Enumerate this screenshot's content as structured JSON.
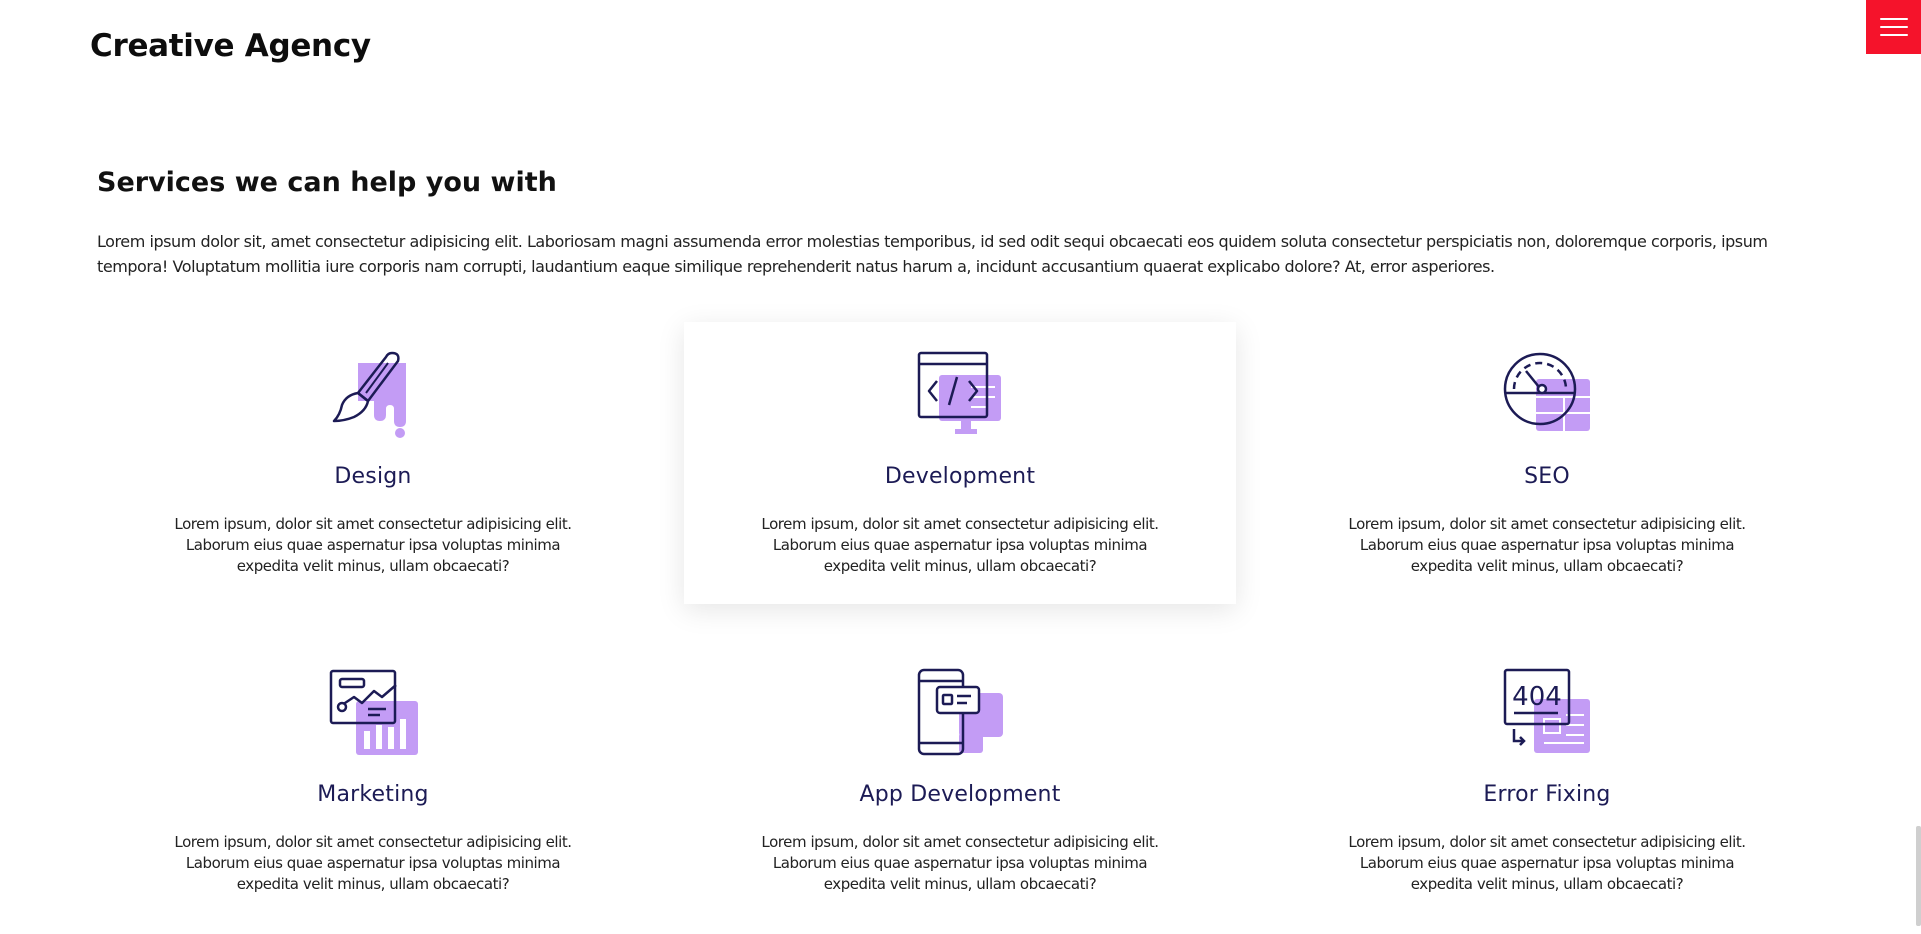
{
  "header": {
    "logo": "Creative Agency",
    "menu_icon": "hamburger-menu-icon",
    "menu_color": "#f5132b"
  },
  "services": {
    "title": "Services we can help you with",
    "description": "Lorem ipsum dolor sit, amet consectetur adipisicing elit. Laboriosam magni assumenda error molestias temporibus, id sed odit sequi obcaecati eos quidem soluta consectetur perspiciatis non, doloremque corporis, ipsum tempora! Voluptatum mollitia iure corporis nam corrupti, laudantium eaque similique reprehenderit natus harum a, incidunt accusantium quaerat explicabo dolore? At, error asperiores.",
    "accent_color": "#c39cf5",
    "icon_stroke_color": "#1c1b55",
    "items": [
      {
        "title": "Design",
        "icon": "paint-brush-icon",
        "text": "Lorem ipsum, dolor sit amet consectetur adipisicing elit. Laborum eius quae aspernatur ipsa voluptas minima expedita velit minus, ullam obcaecati?"
      },
      {
        "title": "Development",
        "icon": "code-monitor-icon",
        "text": "Lorem ipsum, dolor sit amet consectetur adipisicing elit. Laborum eius quae aspernatur ipsa voluptas minima expedita velit minus, ullam obcaecati?"
      },
      {
        "title": "SEO",
        "icon": "speedometer-icon",
        "text": "Lorem ipsum, dolor sit amet consectetur adipisicing elit. Laborum eius quae aspernatur ipsa voluptas minima expedita velit minus, ullam obcaecati?"
      },
      {
        "title": "Marketing",
        "icon": "analytics-chart-icon",
        "text": "Lorem ipsum, dolor sit amet consectetur adipisicing elit. Laborum eius quae aspernatur ipsa voluptas minima expedita velit minus, ullam obcaecati?"
      },
      {
        "title": "App Development",
        "icon": "mobile-app-icon",
        "text": "Lorem ipsum, dolor sit amet consectetur adipisicing elit. Laborum eius quae aspernatur ipsa voluptas minima expedita velit minus, ullam obcaecati?"
      },
      {
        "title": "Error Fixing",
        "icon": "error-404-icon",
        "text": "Lorem ipsum, dolor sit amet consectetur adipisicing elit. Laborum eius quae aspernatur ipsa voluptas minima expedita velit minus, ullam obcaecati?"
      }
    ]
  }
}
